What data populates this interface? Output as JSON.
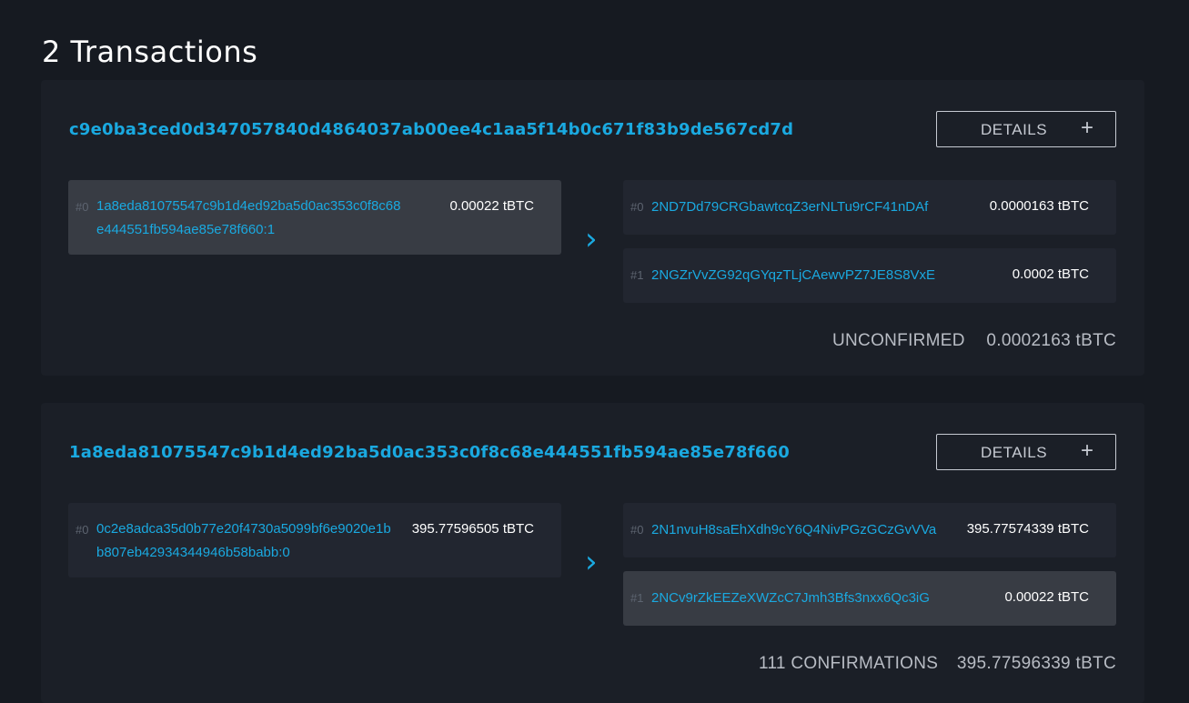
{
  "page_title": "2 Transactions",
  "transactions": [
    {
      "hash": "c9e0ba3ced0d347057840d4864037ab00ee4c1aa5f14b0c671f83b9de567cd7d",
      "details_label": "DETAILS",
      "details_icon": "+",
      "inputs": [
        {
          "index": "#0",
          "address_line1": "1a8eda81075547c9b1d4ed92ba5d0ac353c0f8c68",
          "address_line2": "e444551fb594ae85e78f660:1",
          "amount": "0.00022 tBTC"
        }
      ],
      "arrow": "›",
      "outputs": [
        {
          "index": "#0",
          "address": "2ND7Dd79CRGbawtcqZ3erNLTu9rCF41nDAf",
          "amount": "0.0000163 tBTC"
        },
        {
          "index": "#1",
          "address": "2NGZrVvZG92qGYqzTLjCAewvPZ7JE8S8VxE",
          "amount": "0.0002 tBTC"
        }
      ],
      "status": "UNCONFIRMED",
      "total": "0.0002163 tBTC"
    },
    {
      "hash": "1a8eda81075547c9b1d4ed92ba5d0ac353c0f8c68e444551fb594ae85e78f660",
      "details_label": "DETAILS",
      "details_icon": "+",
      "inputs": [
        {
          "index": "#0",
          "address_line1": "0c2e8adca35d0b77e20f4730a5099bf6e9020e1b",
          "address_line2": "b807eb42934344946b58babb:0",
          "amount": "395.77596505 tBTC"
        }
      ],
      "arrow": "›",
      "outputs": [
        {
          "index": "#0",
          "address": "2N1nvuH8saEhXdh9cY6Q4NivPGzGCzGvVVa",
          "amount": "395.77574339 tBTC"
        },
        {
          "index": "#1",
          "address": "2NCv9rZkEEZeXWZcC7Jmh3Bfs3nxx6Qc3iG",
          "amount": "0.00022 tBTC"
        }
      ],
      "status": "111 CONFIRMATIONS",
      "total": "395.77596339 tBTC"
    }
  ],
  "colors": {
    "accent": "#1aa9e0",
    "background": "#161a21",
    "card": "#1b1f27",
    "highlight_row": "#383c44"
  }
}
